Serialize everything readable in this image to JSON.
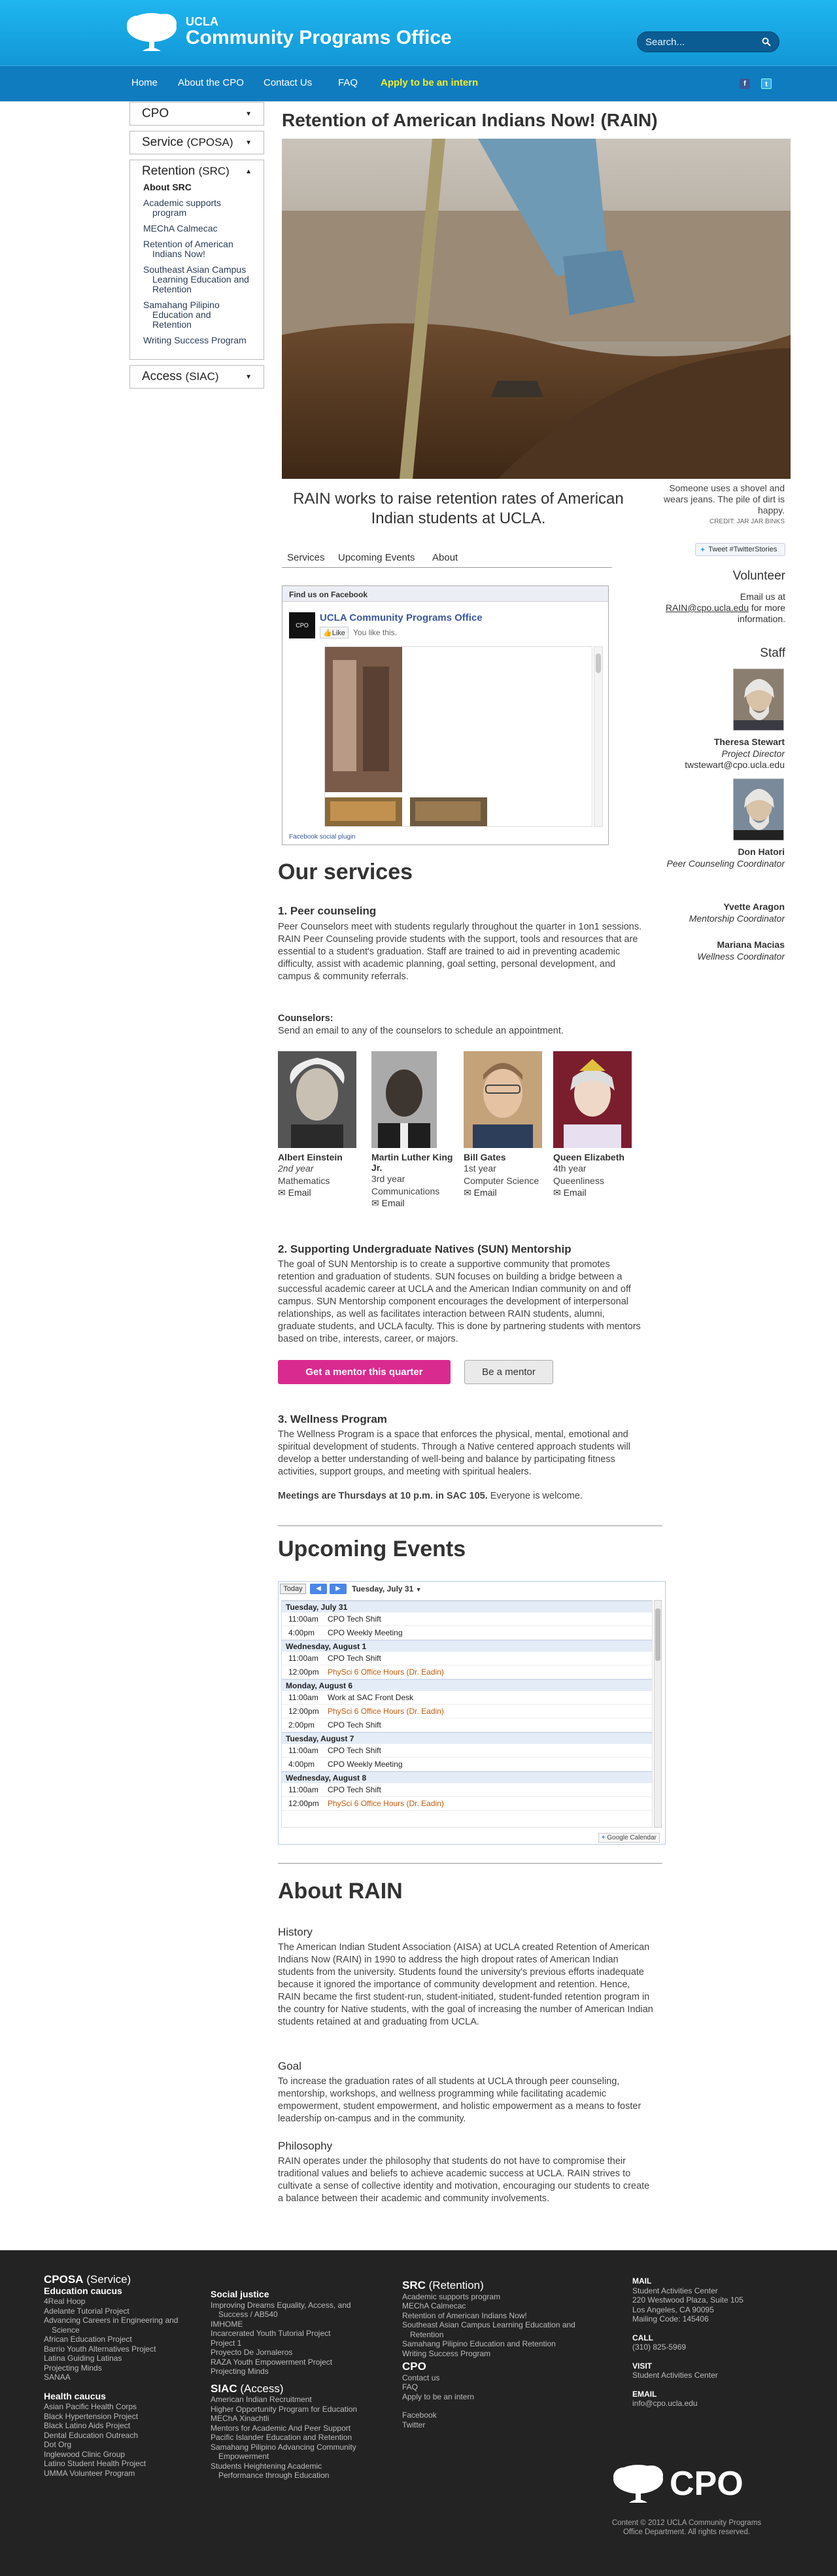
{
  "header": {
    "logo_ucla": "UCLA",
    "logo_name": "Community Programs Office",
    "search_placeholder": "Search...",
    "nav": [
      "Home",
      "About the CPO",
      "Contact Us",
      "FAQ"
    ],
    "nav_intern": "Apply to be an intern",
    "social": [
      "f",
      "t"
    ]
  },
  "sidebar": {
    "boxes": [
      {
        "title": "CPO",
        "paren": ""
      },
      {
        "title": "Service",
        "paren": "(CPOSA)"
      },
      {
        "title": "Retention",
        "paren": "(SRC)"
      },
      {
        "title": "Access",
        "paren": "(SIAC)"
      }
    ],
    "items": [
      "About SRC",
      "Academic supports program",
      "MEChA Calmecac",
      "Retention of American Indians Now!",
      "Southeast Asian Campus Learning Education and Retention",
      "Samahang Pilipino Education and Retention",
      "Writing Success Program"
    ]
  },
  "main": {
    "title": "Retention of American Indians Now! (RAIN)",
    "caption": "Someone uses a shovel and wears jeans. The pile of dirt is happy.",
    "credit": "CREDIT: JAR JAR BINKS",
    "tagline": "RAIN works to raise retention rates of American Indian students at UCLA.",
    "tabs": [
      "Services",
      "Upcoming Events",
      "About"
    ],
    "tweet": "Tweet #TwitterStories"
  },
  "facebook": {
    "bar": "Find us on Facebook",
    "page_name": "UCLA Community Programs Office",
    "like": "Like",
    "you_like": "You like this.",
    "logo": "CPO",
    "footer": "Facebook social plugin"
  },
  "right": {
    "volunteer_heading": "Volunteer",
    "volunteer_pre": "Email us at",
    "volunteer_email": "RAIN@cpo.ucla.edu",
    "volunteer_post": "for more information.",
    "staff_heading": "Staff",
    "staff": [
      {
        "name": "Theresa Stewart",
        "role": "Project Director",
        "email": "twstewart@cpo.ucla.edu"
      },
      {
        "name": "Don Hatori",
        "role": "Peer Counseling Coordinator",
        "email": ""
      },
      {
        "name": "Yvette Aragon",
        "role": "Mentorship Coordinator",
        "email": ""
      },
      {
        "name": "Mariana Macias",
        "role": "Wellness Coordinator",
        "email": ""
      }
    ]
  },
  "services": {
    "heading": "Our services",
    "s1_title": "1. Peer counseling",
    "s1_text": "Peer Counselors meet with students regularly throughout the quarter in 1on1 sessions. RAIN Peer Counseling provide students with the support, tools and resources that are essential to a student's graduation. Staff are trained to aid in preventing academic difficulty, assist with academic planning, goal setting, personal development, and campus & community referrals.",
    "counselors_label": "Counselors:",
    "counselors_text": "Send an email to any of the counselors to schedule an appointment.",
    "counselors": [
      {
        "name": "Albert Einstein",
        "year": "2nd year",
        "major": "Mathematics",
        "email": "Email"
      },
      {
        "name": "Martin Luther King Jr.",
        "year": "3rd year",
        "major": "Communications",
        "email": "Email"
      },
      {
        "name": "Bill Gates",
        "year": "1st year",
        "major": "Computer Science",
        "email": "Email"
      },
      {
        "name": "Queen Elizabeth",
        "year": "4th year",
        "major": "Queenliness",
        "email": "Email"
      }
    ],
    "s2_title": "2. Supporting Undergraduate Natives (SUN) Mentorship",
    "s2_text": "The goal of SUN Mentorship is to create a supportive community that promotes retention and graduation of students. SUN focuses on building a bridge between a successful academic career at UCLA and the American Indian community on and off campus. SUN Mentorship component encourages the development of interpersonal relationships, as well as facilitates interaction between RAIN students, alumni, graduate students, and UCLA faculty. This is done by partnering students with mentors based on tribe, interests, career, or majors.",
    "btn_mentor_get": "Get a mentor this quarter",
    "btn_mentor_be": "Be a mentor",
    "s3_title": "3. Wellness Program",
    "s3_text": "The Wellness Program is a space that enforces the physical, mental, emotional and spiritual development of students. Through a Native centered approach students will develop a better understanding of well-being and balance by participating fitness activities, support groups, and meeting with spiritual healers.",
    "s3_meet_bold": "Meetings are Thursdays at 10 p.m. in SAC 105.",
    "s3_meet_rest": " Everyone is welcome."
  },
  "events": {
    "heading": "Upcoming Events",
    "today": "Today",
    "date": "Tuesday, July 31",
    "google": "Google Calendar",
    "days": [
      {
        "label": "Tuesday, July 31",
        "events": [
          {
            "time": "11:00am",
            "title": "CPO Tech Shift",
            "hl": false
          },
          {
            "time": "4:00pm",
            "title": "CPO Weekly Meeting",
            "hl": false
          }
        ]
      },
      {
        "label": "Wednesday, August 1",
        "events": [
          {
            "time": "11:00am",
            "title": "CPO Tech Shift",
            "hl": false
          },
          {
            "time": "12:00pm",
            "title": "PhySci 6 Office Hours (Dr. Eadin)",
            "hl": true
          }
        ]
      },
      {
        "label": "Monday, August 6",
        "events": [
          {
            "time": "11:00am",
            "title": "Work at SAC Front Desk",
            "hl": false
          },
          {
            "time": "12:00pm",
            "title": "PhySci 6 Office Hours (Dr. Eadin)",
            "hl": true
          },
          {
            "time": "2:00pm",
            "title": "CPO Tech Shift",
            "hl": false
          }
        ]
      },
      {
        "label": "Tuesday, August 7",
        "events": [
          {
            "time": "11:00am",
            "title": "CPO Tech Shift",
            "hl": false
          },
          {
            "time": "4:00pm",
            "title": "CPO Weekly Meeting",
            "hl": false
          }
        ]
      },
      {
        "label": "Wednesday, August 8",
        "events": [
          {
            "time": "11:00am",
            "title": "CPO Tech Shift",
            "hl": false
          },
          {
            "time": "12:00pm",
            "title": "PhySci 6 Office Hours (Dr. Eadin)",
            "hl": true
          }
        ]
      }
    ]
  },
  "about": {
    "heading": "About RAIN",
    "history_title": "History",
    "history_text": "The American Indian Student Association (AISA) at UCLA created Retention of American Indians Now (RAIN) in 1990 to address the high dropout rates of American Indian students from the university. Students found the university's previous efforts inadequate because it ignored the importance of community development and retention. Hence, RAIN became the first student-run, student-initiated, student-funded retention program in the country for Native students, with the goal of increasing the number of American Indian students retained at and graduating from UCLA.",
    "goal_title": "Goal",
    "goal_text": "To increase the graduation rates of all students at UCLA through peer counseling, mentorship, workshops, and wellness programming while facilitating academic empowerment, student empowerment, and holistic empowerment as a means to foster leadership on-campus and in the community.",
    "phil_title": "Philosophy",
    "phil_text": "RAIN operates under the philosophy that students do not have to compromise their traditional values and beliefs to achieve academic success at UCLA. RAIN strives to cultivate a sense of collective identity and motivation, encouraging our students to create a balance between their academic and community involvements."
  },
  "footer": {
    "col1_title": "CPOSA",
    "col1_paren": "(Service)",
    "col1_sub1": "Education caucus",
    "col1_edu": [
      "4Real Hoop",
      "Adelante Tutorial Project",
      "Advancing Careers in Engineering and Science",
      "African Education Project",
      "Barrio Youth Alternatives Project",
      "Latina Guiding Latinas",
      "Projecting Minds",
      "SANAA"
    ],
    "col1_sub2": "Health caucus",
    "col1_health": [
      "Asian Pacific Health Corps",
      "Black Hypertension Project",
      "Black Latino Aids Project",
      "Dental Education Outreach",
      "Dot Org",
      "Inglewood Clinic Group",
      "Latino Student Health Project",
      "UMMA Volunteer Program"
    ],
    "col2_sub1": "Social justice",
    "col2_sj": [
      "Improving Dreams Equality, Access, and Success / AB540",
      "IMHOME",
      "Incarcerated Youth Tutorial Project",
      "Project 1",
      "Proyecto De Jornaleros",
      "RAZA Youth Empowerment Project",
      "Projecting Minds"
    ],
    "col2_title": "SIAC",
    "col2_paren": "(Access)",
    "col2_access": [
      "American Indian Recruitment",
      "Higher Opportunity Program for Education",
      "MEChA Xinachtli",
      "Mentors for Academic And Peer Support",
      "Pacific Islander Education and Retention",
      "Samahang Pilipino Advancing Community Empowerment",
      "Students Heightening Academic Performance through Education"
    ],
    "col3_title": "SRC",
    "col3_paren": "(Retention)",
    "col3_src": [
      "Academic supports program",
      "MEChA Calmecac",
      "Retention of American Indians Now!",
      "Southeast Asian Campus Learning Education and Retention",
      "Samahang Pilipino Education and Retention",
      "Writing Success Program"
    ],
    "col3_cpo": "CPO",
    "col3_cpo_items": [
      "Contact us",
      "FAQ",
      "Apply to be an intern"
    ],
    "col3_social": [
      "Facebook",
      "Twitter"
    ],
    "mail_label": "MAIL",
    "mail": [
      "Student Activities Center",
      "220 Westwood Plaza, Suite 105",
      "Los Angeles, CA 90095",
      "Mailing Code: 145406"
    ],
    "call_label": "CALL",
    "call": "(310) 825-5969",
    "visit_label": "VISIT",
    "visit": "Student Activities Center",
    "email_label": "EMAIL",
    "email": "info@cpo.ucla.edu",
    "logo": "CPO",
    "copyright": "Content © 2012 UCLA Community Programs Office Department. All rights reserved."
  }
}
